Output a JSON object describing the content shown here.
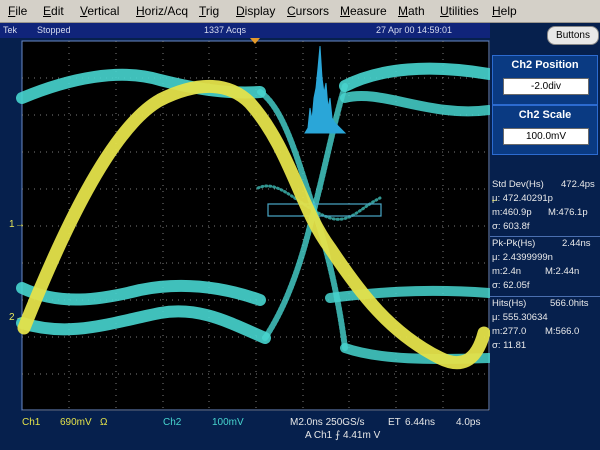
{
  "menu": {
    "items": [
      "File",
      "Edit",
      "Vertical",
      "Horiz/Acq",
      "Trig",
      "Display",
      "Cursors",
      "Measure",
      "Math",
      "Utilities",
      "Help"
    ]
  },
  "status": {
    "brand": "Tek",
    "state": "Stopped",
    "acqs": "1337 Acqs",
    "datetime": "27 Apr 00 14:59:01"
  },
  "buttons_label": "Buttons",
  "controls": {
    "ch2_position": {
      "title": "Ch2 Position",
      "value": "-2.0div"
    },
    "ch2_scale": {
      "title": "Ch2 Scale",
      "value": "100.0mV"
    }
  },
  "measurements": {
    "std_dev": {
      "title": "Std Dev(Hs)",
      "value": "472.4ps",
      "mu": "μ: 472.40291p",
      "m_min": "m:460.9p",
      "m_max": "M:476.1p",
      "sigma": "σ: 603.8f"
    },
    "pk_pk": {
      "title": "Pk-Pk(Hs)",
      "value": "2.44ns",
      "mu": "μ: 2.4399999n",
      "m_min": "m:2.4n",
      "m_max": "M:2.44n",
      "sigma": "σ: 62.05f"
    },
    "hits": {
      "title": "Hits(Hs)",
      "value": "566.0hits",
      "mu": "μ: 555.30634",
      "m_min": "m:277.0",
      "m_max": "M:566.0",
      "sigma": "σ: 11.81"
    }
  },
  "channel_markers": {
    "ch1": "1",
    "ch2": "2"
  },
  "bottom": {
    "ch1_label": "Ch1",
    "ch1_scale": "690mV",
    "ch1_coupling": "Ω",
    "ch2_label": "Ch2",
    "ch2_scale": "100mV",
    "timebase": "M2.0ns 250GS/s",
    "et": "ET",
    "et_value": "6.44ns",
    "ps_value": "4.0ps",
    "trigger": "A  Ch1  ⨍  4.41m   V"
  },
  "colors": {
    "ch1": "#e4e24a",
    "ch2": "#47d5cf",
    "histogram": "#2aa6d8",
    "screen_bg": "#000000",
    "frame": "#06204d"
  }
}
